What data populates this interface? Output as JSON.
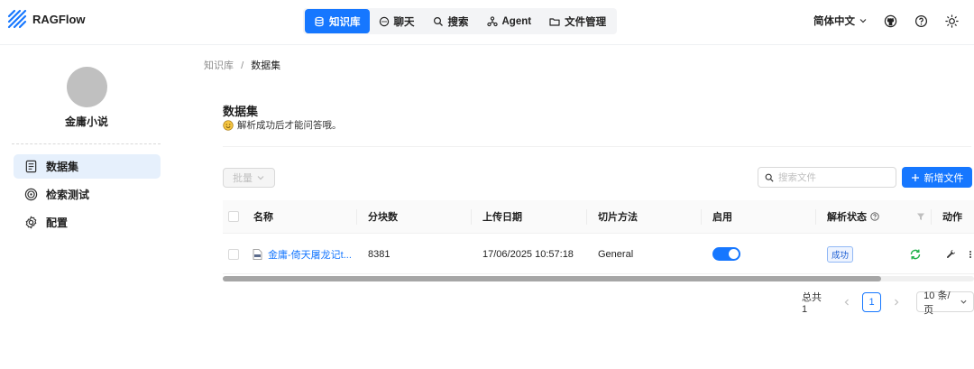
{
  "app": {
    "name": "RAGFlow"
  },
  "nav": {
    "items": [
      {
        "label": "知识库",
        "active": true,
        "icon": "database-icon"
      },
      {
        "label": "聊天",
        "active": false,
        "icon": "chat-icon"
      },
      {
        "label": "搜索",
        "active": false,
        "icon": "search-icon"
      },
      {
        "label": "Agent",
        "active": false,
        "icon": "agent-icon"
      },
      {
        "label": "文件管理",
        "active": false,
        "icon": "folder-icon"
      }
    ]
  },
  "header": {
    "language": "简体中文"
  },
  "sidebar": {
    "kb_name": "金庸小说",
    "items": [
      {
        "label": "数据集",
        "active": true,
        "icon": "document-icon"
      },
      {
        "label": "检索测试",
        "active": false,
        "icon": "target-icon"
      },
      {
        "label": "配置",
        "active": false,
        "icon": "gear-icon"
      }
    ]
  },
  "breadcrumb": {
    "parent": "知识库",
    "separator": "/",
    "current": "数据集"
  },
  "page": {
    "title": "数据集",
    "description": "解析成功后才能问答哦。"
  },
  "toolbar": {
    "batch_label": "批量",
    "search_placeholder": "搜索文件",
    "add_label": "新增文件"
  },
  "table": {
    "columns": [
      "名称",
      "分块数",
      "上传日期",
      "切片方法",
      "启用",
      "解析状态",
      "动作"
    ],
    "rows": [
      {
        "name": "金庸-倚天屠龙记t...",
        "chunks": "8381",
        "upload_date": "17/06/2025 10:57:18",
        "method": "General",
        "enabled": true,
        "status": "成功"
      }
    ]
  },
  "pagination": {
    "total": "总共 1",
    "current": "1",
    "page_size": "10 条/页"
  },
  "colors": {
    "accent": "#1677ff",
    "success": "#22b14c"
  }
}
